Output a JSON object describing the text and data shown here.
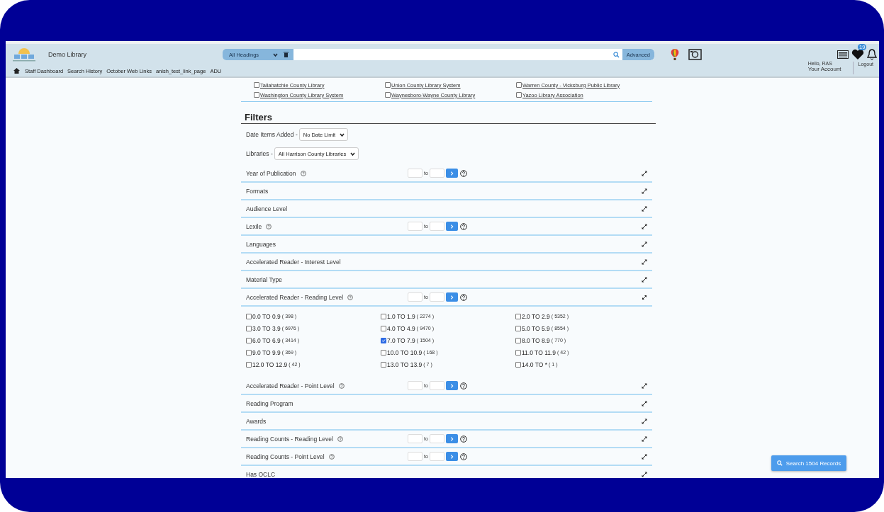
{
  "header": {
    "site_name": "Demo Library",
    "nav": [
      "Staff Dashboard",
      "Search History",
      "October Web Links",
      "anish_test_link_page",
      "ADU"
    ],
    "search": {
      "scope": "All Headings",
      "advanced": "Advanced"
    },
    "favorites_badge": "19",
    "account": {
      "greeting": "Hello, RAS",
      "label": "Your Account",
      "logout": "Logout"
    }
  },
  "libraries": [
    {
      "name": "Tallahatchie County Library",
      "checked": false
    },
    {
      "name": "Union County Library System",
      "checked": false
    },
    {
      "name": "Warren County - Vicksburg Public Library",
      "checked": false
    },
    {
      "name": "Washington County Library System",
      "checked": false
    },
    {
      "name": "Waynesboro-Wayne County Library",
      "checked": false
    },
    {
      "name": "Yazoo Library Association",
      "checked": false
    }
  ],
  "filters_title": "Filters",
  "date_filter": {
    "label": "Date Items Added -",
    "value": "No Date Limit"
  },
  "library_filter": {
    "label": "Libraries -",
    "value": "All Harrison County Libraries"
  },
  "facets": [
    {
      "kind": "range",
      "label": "Year of Publication",
      "to": "to",
      "expanded": false
    },
    {
      "kind": "plain",
      "label": "Formats",
      "expanded": false
    },
    {
      "kind": "plain",
      "label": "Audience Level",
      "expanded": false
    },
    {
      "kind": "range",
      "label": "Lexile",
      "to": "to",
      "expanded": false
    },
    {
      "kind": "plain",
      "label": "Languages",
      "expanded": false
    },
    {
      "kind": "plain",
      "label": "Accelerated Reader - Interest Level",
      "expanded": false
    },
    {
      "kind": "plain",
      "label": "Material Type",
      "expanded": false
    },
    {
      "kind": "range",
      "label": "Accelerated Reader - Reading Level",
      "to": "to",
      "expanded": true,
      "options": [
        {
          "range": "0.0 TO 0.9",
          "count": "( 398 )",
          "checked": false
        },
        {
          "range": "1.0 TO 1.9",
          "count": "( 2274 )",
          "checked": false
        },
        {
          "range": "2.0 TO 2.9",
          "count": "( 5352 )",
          "checked": false
        },
        {
          "range": "3.0 TO 3.9",
          "count": "( 6976 )",
          "checked": false
        },
        {
          "range": "4.0 TO 4.9",
          "count": "( 9470 )",
          "checked": false
        },
        {
          "range": "5.0 TO 5.9",
          "count": "( 8554 )",
          "checked": false
        },
        {
          "range": "6.0 TO 6.9",
          "count": "( 3414 )",
          "checked": false
        },
        {
          "range": "7.0 TO 7.9",
          "count": "( 1504 )",
          "checked": true
        },
        {
          "range": "8.0 TO 8.9",
          "count": "( 770 )",
          "checked": false
        },
        {
          "range": "9.0 TO 9.9",
          "count": "( 369 )",
          "checked": false
        },
        {
          "range": "10.0 TO 10.9",
          "count": "( 168 )",
          "checked": false
        },
        {
          "range": "11.0 TO 11.9",
          "count": "( 42 )",
          "checked": false
        },
        {
          "range": "12.0 TO 12.9",
          "count": "( 42 )",
          "checked": false
        },
        {
          "range": "13.0 TO 13.9",
          "count": "( 7 )",
          "checked": false
        },
        {
          "range": "14.0 TO *",
          "count": "( 1 )",
          "checked": false
        }
      ]
    },
    {
      "kind": "range",
      "label": "Accelerated Reader - Point Level",
      "to": "to",
      "expanded": false
    },
    {
      "kind": "plain",
      "label": "Reading Program",
      "expanded": false
    },
    {
      "kind": "plain",
      "label": "Awards",
      "expanded": false
    },
    {
      "kind": "range",
      "label": "Reading Counts - Reading Level",
      "to": "to",
      "expanded": false
    },
    {
      "kind": "range",
      "label": "Reading Counts - Point Level",
      "to": "to",
      "expanded": false
    },
    {
      "kind": "plain",
      "label": "Has OCLC",
      "expanded": false
    }
  ],
  "search_button": "Search 1504 Records"
}
